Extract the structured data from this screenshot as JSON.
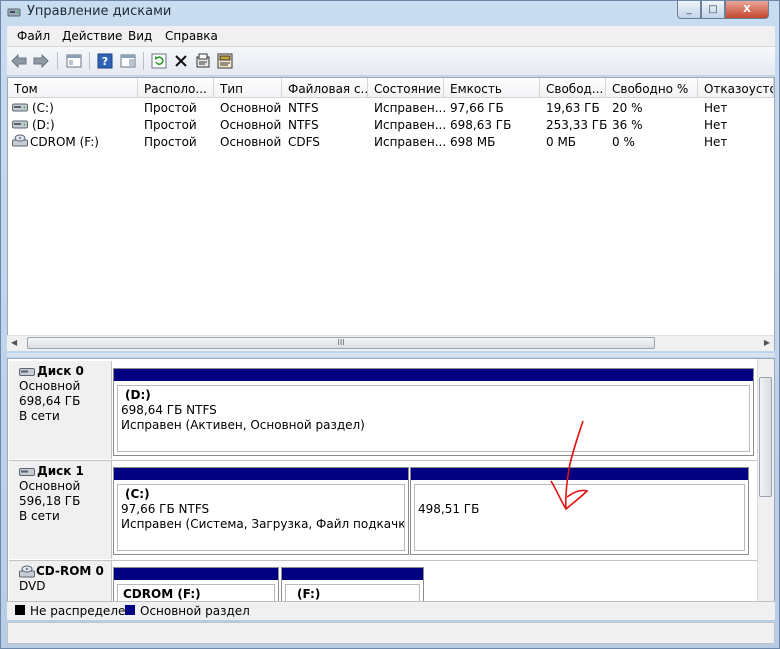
{
  "window": {
    "title": "Управление дисками",
    "controls": [
      "_",
      "□",
      "X"
    ]
  },
  "menu": [
    "Файл",
    "Действие",
    "Вид",
    "Справка"
  ],
  "toolbar": [
    "back-icon",
    "forward-icon",
    "panel-icon",
    "help-icon",
    "console-tree-icon",
    "refresh-icon",
    "delete-icon",
    "properties-icon",
    "rescan-icon"
  ],
  "volumes": {
    "headers": [
      "Том",
      "Располо...",
      "Тип",
      "Файловая с...",
      "Состояние",
      "Емкость",
      "Свобод...",
      "Свободно %",
      "Отказоустой"
    ],
    "rows": [
      [
        "(C:)",
        "Простой",
        "Основной",
        "NTFS",
        "Исправен...",
        "97,66 ГБ",
        "19,63 ГБ",
        "20 %",
        "Нет"
      ],
      [
        "(D:)",
        "Простой",
        "Основной",
        "NTFS",
        "Исправен...",
        "698,63 ГБ",
        "253,33 ГБ",
        "36 %",
        "Нет"
      ],
      [
        "CDROM (F:)",
        "Простой",
        "Основной",
        "CDFS",
        "Исправен...",
        "698 МБ",
        "0 МБ",
        "0 %",
        "Нет"
      ]
    ],
    "scroll_grip": "III"
  },
  "disks": [
    {
      "title": "Диск 0",
      "type": "Основной",
      "size": "698,64 ГБ",
      "status": "В сети",
      "partitions": [
        {
          "name": "(D:)",
          "size": "698,64 ГБ NTFS",
          "status": "Исправен (Активен, Основной раздел)"
        }
      ]
    },
    {
      "title": "Диск 1",
      "type": "Основной",
      "size": "596,18 ГБ",
      "status": "В сети",
      "partitions": [
        {
          "name": "(C:)",
          "size": "97,66 ГБ NTFS",
          "status": "Исправен (Система, Загрузка, Файл подкачки, Акти"
        },
        {
          "size": "498,51 ГБ"
        }
      ]
    },
    {
      "title": "CD-ROM 0",
      "type": "DVD",
      "partitions": [
        {
          "name": "CDROM  (F:)"
        },
        {
          "name": "(F:)"
        }
      ]
    }
  ],
  "legend": [
    {
      "label": "Не распределен",
      "color": "#000000"
    },
    {
      "label": "Основной раздел",
      "color": "#000080"
    }
  ],
  "annotation_color": "#e0140f"
}
